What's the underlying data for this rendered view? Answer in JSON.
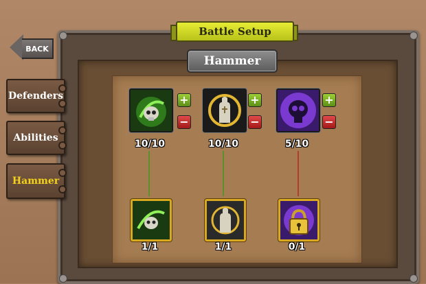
{
  "header": {
    "title": "Battle Setup",
    "back_label": "BACK"
  },
  "panel": {
    "title": "Hammer"
  },
  "sidebar": {
    "items": [
      {
        "label": "Defenders",
        "active": false
      },
      {
        "label": "Abilities",
        "active": false
      },
      {
        "label": "Hammer",
        "active": true
      }
    ]
  },
  "upgrades": [
    {
      "icon": "green-skull-icon",
      "level": "10/10",
      "bonus": "1/1",
      "line_color": "#5f8f28"
    },
    {
      "icon": "golden-hand-icon",
      "level": "10/10",
      "bonus": "1/1",
      "line_color": "#5f8f28"
    },
    {
      "icon": "purple-skull-icon",
      "level": "5/10",
      "bonus": "0/1",
      "line_color": "#b53a2c",
      "bonus_locked": true
    }
  ],
  "colors": {
    "accent_yellow": "#f3d21b",
    "plus": "#7cb428",
    "minus": "#c43030"
  }
}
